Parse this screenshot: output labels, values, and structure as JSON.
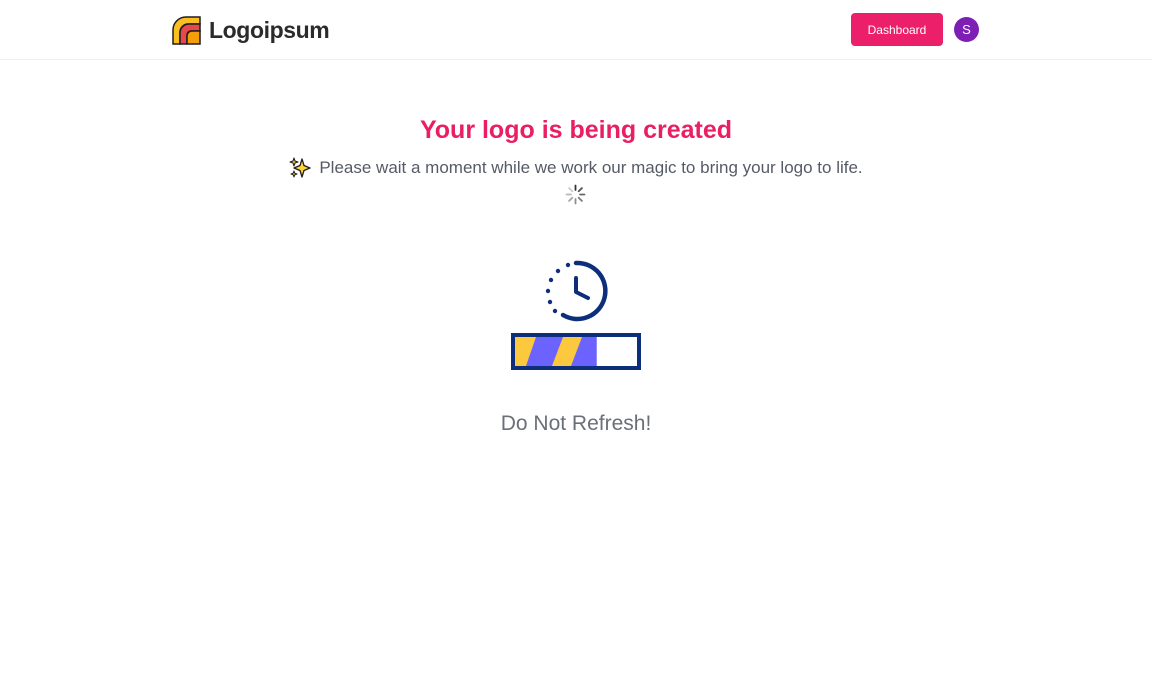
{
  "header": {
    "brand_name": "Logoipsum",
    "brand_icon": "logoipsum-mark-icon",
    "dashboard_label": "Dashboard",
    "avatar_initial": "S",
    "colors": {
      "dashboard_button": "#ec1f6a",
      "avatar": "#7d1fb5"
    }
  },
  "main": {
    "title": "Your logo is being created",
    "subtitle": "Please wait a moment while we work our magic to bring your logo to life.",
    "subtitle_icon": "sparkles-icon",
    "spinner_icon": "spinner-icon",
    "illustration_icon": "clock-progress-icon",
    "progress_fraction": 0.67,
    "warning": "Do Not Refresh!",
    "colors": {
      "title": "#e91e63",
      "illustration_navy": "#0d2e7a",
      "progress_purple": "#6c63ff",
      "progress_yellow": "#fcc83d"
    }
  }
}
